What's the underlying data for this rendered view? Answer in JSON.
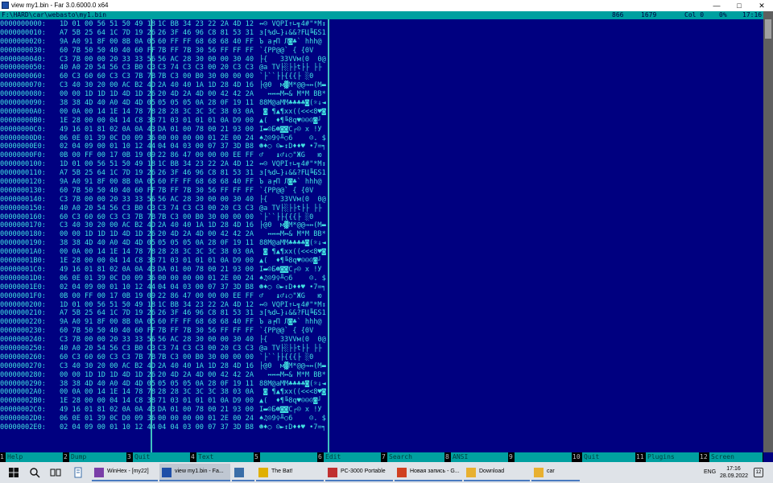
{
  "window": {
    "title": "view my1.bin - Far 3.0.6000.0 x64",
    "minimize": "—",
    "maximize": "□",
    "close": "✕"
  },
  "status": {
    "path": "F:\\HARD\\car\\webasto\\my1.bin",
    "codepage": "866",
    "size": "1679",
    "col": "Col 0",
    "percent": "0%",
    "time": "17:16"
  },
  "rows": [
    {
      "off": "0000000000:",
      "b1": "1D 01 00 56 51 50 49 18",
      "b2": "1C BB 34 23 22 2A 4D 12",
      "ch": "↔☺ VQPI↑∟╗4#\"*M↕"
    },
    {
      "off": "0000000010:",
      "b1": "A7 5B 25 64 1C 7D 19 26",
      "b2": "26 3F 46 96 C8 81 53 31",
      "ch": "з[%d∟}↓&&?FЦ╚БS1"
    },
    {
      "off": "0000000020:",
      "b1": "9A A0 91 8F 00 8B 0A 05",
      "b2": "60 FF FF 68 68 68 40 FF",
      "ch": "Ъ а╒П Л◙♣` hhh@ "
    },
    {
      "off": "0000000030:",
      "b1": "60 7B 50 50 40 40 60 FF",
      "b2": "7B FF 7B 30 56 FF FF FF",
      "ch": "`{PP@@` { {0V   "
    },
    {
      "off": "0000000040:",
      "b1": "C3 7B 00 00 20 33 33 56",
      "b2": "56 AC 28 30 00 00 30 40",
      "ch": "├{   33VVм(0  0@"
    },
    {
      "off": "0000000050:",
      "b1": "40 A0 20 54 56 C3 B0 C3",
      "b2": "C3 74 C3 C3 00 20 C3 C3",
      "ch": "@а TV├░├├t├├ ├├"
    },
    {
      "off": "0000000060:",
      "b1": "60 C3 60 60 C3 C3 7B 7B",
      "b2": "7B C3 00 B0 30 00 00 00",
      "ch": "`├``├├{{{├ ░0   "
    },
    {
      "off": "0000000070:",
      "b1": "C3 40 30 20 00 AC B2 4D",
      "b2": "2A 40 40 1A 1D 28 4D 16",
      "ch": "├@0  м▓M*@@→↔(M▬"
    },
    {
      "off": "0000000080:",
      "b1": "00 00 1D 1D 1D 4D 1D 26",
      "b2": "20 4D 2A 4D 00 42 42 2A",
      "ch": "  ↔↔↔M↔& M*M BB*"
    },
    {
      "off": "0000000090:",
      "b1": "38 38 4D 40 A0 4D 4D 05",
      "b2": "05 05 05 0A 28 0F 19 11",
      "ch": "88M@аMM♣♣♣♣◙(☼↓◄"
    },
    {
      "off": "00000000A0:",
      "b1": "00 0A 00 14 1E 14 78 78",
      "b2": "28 28 3C 3C 3C 38 03 0A",
      "ch": " ◙ ¶▲¶xx((<<<8♥◙"
    },
    {
      "off": "00000000B0:",
      "b1": "1E 28 00 00 04 14 C8 38",
      "b2": "71 03 01 01 01 0A D9 00",
      "ch": "▲(  ♦¶╚8q♥☺☺☺◙┘ "
    },
    {
      "off": "00000000C0:",
      "b1": "49 16 01 81 02 0A 0A 43",
      "b2": "DA 01 00 78 00 21 93 00",
      "ch": "I▬☺Б☻◙◙C┌☺ x !У "
    },
    {
      "off": "00000000D0:",
      "b1": "06 0E 01 39 0C D0 09 36",
      "b2": "00 00 00 00 01 2E 00 24",
      "ch": "♠♫☺9♀╨○6    ☺. $"
    },
    {
      "off": "00000000E0:",
      "b1": "02 04 09 00 01 10 12 44",
      "b2": "04 04 03 00 07 37 3D B8",
      "ch": "☻♦○ ☺►↕D♦♦♥ •7=╕"
    },
    {
      "off": "00000000F0:",
      "b1": "0B 00 FF 00 17 0B 19 09",
      "b2": "22 86 47 00 00 00 EE FF",
      "ch": "♂   ↨♂↓○\"ЖG   ю "
    },
    {
      "off": "0000000100:",
      "b1": "1D 01 00 56 51 50 49 18",
      "b2": "1C BB 34 23 22 2A 4D 12",
      "ch": "↔☺ VQPI↑∟╗4#\"*M↕"
    },
    {
      "off": "0000000110:",
      "b1": "A7 5B 25 64 1C 7D 19 26",
      "b2": "26 3F 46 96 C8 81 53 31",
      "ch": "з[%d∟}↓&&?FЦ╚БS1"
    },
    {
      "off": "0000000120:",
      "b1": "9A A0 91 8F 00 8B 0A 05",
      "b2": "60 FF FF 68 68 68 40 FF",
      "ch": "Ъ а╒П Л◙♣` hhh@ "
    },
    {
      "off": "0000000130:",
      "b1": "60 7B 50 50 40 40 60 FF",
      "b2": "7B FF 7B 30 56 FF FF FF",
      "ch": "`{PP@@` { {0V   "
    },
    {
      "off": "0000000140:",
      "b1": "C3 7B 00 00 20 33 33 56",
      "b2": "56 AC 28 30 00 00 30 40",
      "ch": "├{   33VVм(0  0@"
    },
    {
      "off": "0000000150:",
      "b1": "40 A0 20 54 56 C3 B0 C3",
      "b2": "C3 74 C3 C3 00 20 C3 C3",
      "ch": "@а TV├░├├t├├ ├├"
    },
    {
      "off": "0000000160:",
      "b1": "60 C3 60 60 C3 C3 7B 7B",
      "b2": "7B C3 00 B0 30 00 00 00",
      "ch": "`├``├├{{{├ ░0   "
    },
    {
      "off": "0000000170:",
      "b1": "C3 40 30 20 00 AC B2 4D",
      "b2": "2A 40 40 1A 1D 28 4D 16",
      "ch": "├@0  м▓M*@@→↔(M▬"
    },
    {
      "off": "0000000180:",
      "b1": "00 00 1D 1D 1D 4D 1D 26",
      "b2": "20 4D 2A 4D 00 42 42 2A",
      "ch": "  ↔↔↔M↔& M*M BB*"
    },
    {
      "off": "0000000190:",
      "b1": "38 38 4D 40 A0 4D 4D 05",
      "b2": "05 05 05 0A 28 0F 19 11",
      "ch": "88M@аMM♣♣♣♣◙(☼↓◄"
    },
    {
      "off": "00000001A0:",
      "b1": "00 0A 00 14 1E 14 78 78",
      "b2": "28 28 3C 3C 3C 38 03 0A",
      "ch": " ◙ ¶▲¶xx((<<<8♥◙"
    },
    {
      "off": "00000001B0:",
      "b1": "1E 28 00 00 04 14 C8 38",
      "b2": "71 03 01 01 01 0A D9 00",
      "ch": "▲(  ♦¶╚8q♥☺☺☺◙┘ "
    },
    {
      "off": "00000001C0:",
      "b1": "49 16 01 81 02 0A 0A 43",
      "b2": "DA 01 00 78 00 21 93 00",
      "ch": "I▬☺Б☻◙◙C┌☺ x !У "
    },
    {
      "off": "00000001D0:",
      "b1": "06 0E 01 39 0C D0 09 36",
      "b2": "00 00 00 00 01 2E 00 24",
      "ch": "♠♫☺9♀╨○6    ☺. $"
    },
    {
      "off": "00000001E0:",
      "b1": "02 04 09 00 01 10 12 44",
      "b2": "04 04 03 00 07 37 3D B8",
      "ch": "☻♦○ ☺►↕D♦♦♥ •7=╕"
    },
    {
      "off": "00000001F0:",
      "b1": "0B 00 FF 00 17 0B 19 09",
      "b2": "22 86 47 00 00 00 EE FF",
      "ch": "♂   ↨♂↓○\"ЖG   ю "
    },
    {
      "off": "0000000200:",
      "b1": "1D 01 00 56 51 50 49 18",
      "b2": "1C BB 34 23 22 2A 4D 12",
      "ch": "↔☺ VQPI↑∟╗4#\"*M↕"
    },
    {
      "off": "0000000210:",
      "b1": "A7 5B 25 64 1C 7D 19 26",
      "b2": "26 3F 46 96 C8 81 53 31",
      "ch": "з[%d∟}↓&&?FЦ╚БS1"
    },
    {
      "off": "0000000220:",
      "b1": "9A A0 91 8F 00 8B 0A 05",
      "b2": "60 FF FF 68 68 68 40 FF",
      "ch": "Ъ а╒П Л◙♣` hhh@ "
    },
    {
      "off": "0000000230:",
      "b1": "60 7B 50 50 40 40 60 FF",
      "b2": "7B FF 7B 30 56 FF FF FF",
      "ch": "`{PP@@` { {0V   "
    },
    {
      "off": "0000000240:",
      "b1": "C3 7B 00 00 20 33 33 56",
      "b2": "56 AC 28 30 00 00 30 40",
      "ch": "├{   33VVм(0  0@"
    },
    {
      "off": "0000000250:",
      "b1": "40 A0 20 54 56 C3 B0 C3",
      "b2": "C3 74 C3 C3 00 20 C3 C3",
      "ch": "@а TV├░├├t├├ ├├"
    },
    {
      "off": "0000000260:",
      "b1": "60 C3 60 60 C3 C3 7B 7B",
      "b2": "7B C3 00 B0 30 00 00 00",
      "ch": "`├``├├{{{├ ░0   "
    },
    {
      "off": "0000000270:",
      "b1": "C3 40 30 20 00 AC B2 4D",
      "b2": "2A 40 40 1A 1D 28 4D 16",
      "ch": "├@0  м▓M*@@→↔(M▬"
    },
    {
      "off": "0000000280:",
      "b1": "00 00 1D 1D 1D 4D 1D 26",
      "b2": "20 4D 2A 4D 00 42 42 2A",
      "ch": "  ↔↔↔M↔& M*M BB*"
    },
    {
      "off": "0000000290:",
      "b1": "38 38 4D 40 A0 4D 4D 05",
      "b2": "05 05 05 0A 28 0F 19 11",
      "ch": "88M@аMM♣♣♣♣◙(☼↓◄"
    },
    {
      "off": "00000002A0:",
      "b1": "00 0A 00 14 1E 14 78 78",
      "b2": "28 28 3C 3C 3C 38 03 0A",
      "ch": " ◙ ¶▲¶xx((<<<8♥◙"
    },
    {
      "off": "00000002B0:",
      "b1": "1E 28 00 00 04 14 C8 38",
      "b2": "71 03 01 01 01 0A D9 00",
      "ch": "▲(  ♦¶╚8q♥☺☺☺◙┘ "
    },
    {
      "off": "00000002C0:",
      "b1": "49 16 01 81 02 0A 0A 43",
      "b2": "DA 01 00 78 00 21 93 00",
      "ch": "I▬☺Б☻◙◙C┌☺ x !У "
    },
    {
      "off": "00000002D0:",
      "b1": "06 0E 01 39 0C D0 09 36",
      "b2": "00 00 00 00 01 2E 00 24",
      "ch": "♠♫☺9♀╨○6    ☺. $"
    },
    {
      "off": "00000002E0:",
      "b1": "02 04 09 00 01 10 12 44",
      "b2": "04 04 03 00 07 37 3D B8",
      "ch": "☻♦○ ☺►↕D♦♦♥ •7=╕"
    }
  ],
  "keybar": [
    {
      "num": "1",
      "label": "Help"
    },
    {
      "num": "2",
      "label": "Dump"
    },
    {
      "num": "3",
      "label": "Quit"
    },
    {
      "num": "4",
      "label": "Text"
    },
    {
      "num": "5",
      "label": ""
    },
    {
      "num": "6",
      "label": "Edit"
    },
    {
      "num": "7",
      "label": "Search"
    },
    {
      "num": "8",
      "label": "ANSI"
    },
    {
      "num": "9",
      "label": ""
    },
    {
      "num": "10",
      "label": "Quit"
    },
    {
      "num": "11",
      "label": "Plugins"
    },
    {
      "num": "12",
      "label": "Screen"
    }
  ],
  "taskbar": {
    "apps": [
      {
        "label": "WinHex - [my22]",
        "color": "#7a3ea8"
      },
      {
        "label": "view my1.bin - Fa...",
        "color": "#1e4fa8",
        "active": true
      },
      {
        "label": "",
        "color": "#3a6ea8"
      },
      {
        "label": "The Bat!",
        "color": "#e0b000"
      },
      {
        "label": "PC-3000 Portable",
        "color": "#c03030"
      },
      {
        "label": "Новая запись - G...",
        "color": "#d04020"
      },
      {
        "label": "Download",
        "color": "#e8b030"
      },
      {
        "label": "car",
        "color": "#e8b030"
      }
    ],
    "lang": "ENG",
    "time": "17:16",
    "date": "28.09.2022",
    "notifications": "12"
  },
  "colors": {
    "panel_bg": "#000080",
    "text": "#40e0e0",
    "status_bg": "#00a0a0",
    "key_bg": "#00a0a0"
  }
}
